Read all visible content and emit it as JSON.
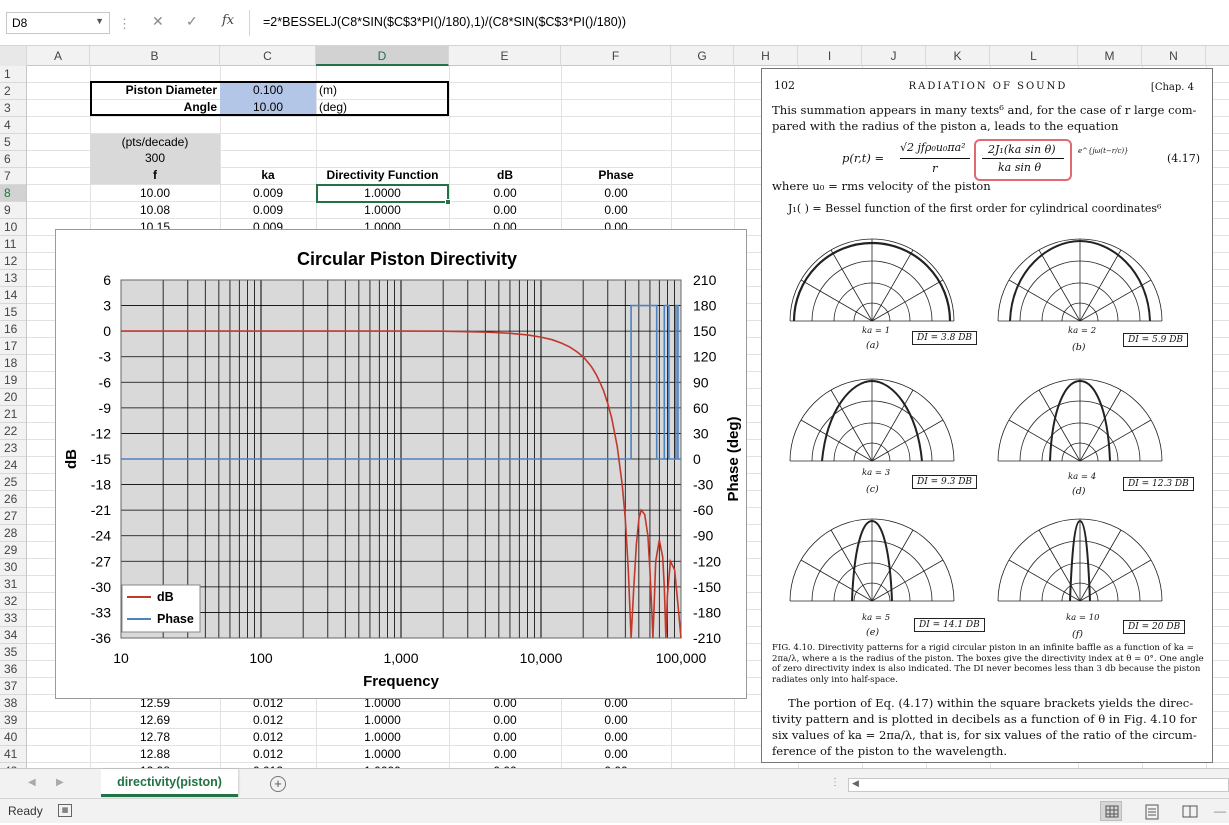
{
  "formula_bar": {
    "name_box": "D8",
    "formula": "=2*BESSELJ(C8*SIN($C$3*PI()/180),1)/(C8*SIN($C$3*PI()/180))"
  },
  "columns": [
    "A",
    "B",
    "C",
    "D",
    "E",
    "F",
    "G",
    "H",
    "I",
    "J",
    "K",
    "L",
    "M",
    "N"
  ],
  "rows": [
    "1",
    "2",
    "3",
    "4",
    "5",
    "6",
    "7",
    "8",
    "9",
    "10",
    "11",
    "12",
    "13",
    "14",
    "15",
    "16",
    "17",
    "18",
    "19",
    "20",
    "21",
    "22",
    "23",
    "24",
    "25",
    "26",
    "27",
    "28",
    "29",
    "30",
    "31",
    "32",
    "33",
    "34",
    "35",
    "36",
    "37",
    "38",
    "39",
    "40",
    "41",
    "42"
  ],
  "inputs": {
    "diameter_label": "Piston Diameter",
    "diameter_value": "0.100",
    "diameter_unit": "(m)",
    "angle_label": "Angle",
    "angle_value": "10.00",
    "angle_unit": "(deg)"
  },
  "pts": {
    "label": "(pts/decade)",
    "value": "300"
  },
  "headers": {
    "f": "f",
    "ka": "ka",
    "dir": "Directivity Function",
    "db": "dB",
    "phase": "Phase"
  },
  "table_top": [
    {
      "f": "10.00",
      "ka": "0.009",
      "dir": "1.0000",
      "db": "0.00",
      "phase": "0.00"
    },
    {
      "f": "10.08",
      "ka": "0.009",
      "dir": "1.0000",
      "db": "0.00",
      "phase": "0.00"
    },
    {
      "f": "10.15",
      "ka": "0.009",
      "dir": "1.0000",
      "db": "0.00",
      "phase": "0.00"
    }
  ],
  "table_bottom": [
    {
      "f": "12.59",
      "ka": "0.012",
      "dir": "1.0000",
      "db": "0.00",
      "phase": "0.00"
    },
    {
      "f": "12.69",
      "ka": "0.012",
      "dir": "1.0000",
      "db": "0.00",
      "phase": "0.00"
    },
    {
      "f": "12.78",
      "ka": "0.012",
      "dir": "1.0000",
      "db": "0.00",
      "phase": "0.00"
    },
    {
      "f": "12.88",
      "ka": "0.012",
      "dir": "1.0000",
      "db": "0.00",
      "phase": "0.00"
    },
    {
      "f": "12.98",
      "ka": "0.012",
      "dir": "1.0000",
      "db": "0.00",
      "phase": "0.00"
    }
  ],
  "chart_data": {
    "type": "line",
    "title": "Circular Piston Directivity",
    "xlabel": "Frequency",
    "ylabel": "dB",
    "y2label": "Phase (deg)",
    "x_scale": "log",
    "xlim": [
      10,
      100000
    ],
    "ylim": [
      -36,
      6
    ],
    "y2lim": [
      -210,
      210
    ],
    "x_ticks": [
      "10",
      "100",
      "1,000",
      "10,000",
      "100,000"
    ],
    "y_ticks": [
      "6",
      "3",
      "0",
      "-3",
      "-6",
      "-9",
      "-12",
      "-15",
      "-18",
      "-21",
      "-24",
      "-27",
      "-30",
      "-33",
      "-36"
    ],
    "y2_ticks": [
      "210",
      "180",
      "150",
      "120",
      "90",
      "60",
      "30",
      "0",
      "-30",
      "-60",
      "-90",
      "-120",
      "-150",
      "-180",
      "-210"
    ],
    "legend_position": "bottom-left",
    "grid": true,
    "series": [
      {
        "name": "dB",
        "color": "#c0392b",
        "axis": "left",
        "x": [
          10,
          1000,
          2000,
          4000,
          6000,
          8000,
          10000,
          12000,
          14000,
          16000,
          18000,
          20000,
          21000,
          22000,
          23000,
          24000,
          25000,
          26000,
          27000,
          28000,
          30000,
          32000,
          35000,
          38000,
          40000,
          42000,
          44000,
          46000,
          48000,
          50000,
          52000,
          55000,
          58000,
          60000,
          62000,
          63000,
          64000,
          66000,
          70000,
          74000,
          76000,
          78000,
          80000,
          84000,
          90000,
          95000,
          100000
        ],
        "y": [
          0.0,
          0.0,
          -0.01,
          -0.11,
          -0.25,
          -0.44,
          -0.7,
          -1.0,
          -1.4,
          -1.85,
          -2.4,
          -3.0,
          -3.4,
          -3.8,
          -4.2,
          -4.7,
          -5.2,
          -5.8,
          -6.4,
          -7.0,
          -8.5,
          -10.2,
          -13.5,
          -18.0,
          -22.0,
          -28.0,
          -36.0,
          -30.0,
          -25.0,
          -22.0,
          -21.0,
          -21.5,
          -24.0,
          -28.0,
          -33.0,
          -36.0,
          -33.0,
          -27.0,
          -24.5,
          -26.5,
          -30.0,
          -36.0,
          -31.0,
          -27.0,
          -28.0,
          -32.0,
          -36.0
        ]
      },
      {
        "name": "Phase",
        "color": "#4f81bd",
        "axis": "right",
        "x": [
          10,
          44000,
          44000,
          67000,
          67000,
          76000,
          76000,
          82000,
          82000,
          92000,
          92000,
          95000,
          95000,
          100000
        ],
        "y": [
          0,
          0,
          180,
          180,
          0,
          0,
          180,
          180,
          0,
          0,
          180,
          180,
          0,
          0
        ]
      }
    ]
  },
  "page": {
    "number": "102",
    "title": "RADIATION OF SOUND",
    "chapter": "[Chap. 4",
    "para1_l1": "This summation appears in many texts⁶ and, for the case of r large com-",
    "para1_l2": "pared with the radius of the piston a, leads to the equation",
    "eq_lhs": "p(r,t) =",
    "eq_num": "√2 jfρ₀u₀πa²",
    "eq_den": "r",
    "eq_box_num": "2J₁(ka sin θ)",
    "eq_box_den": "ka sin θ",
    "eq_exp": "e^{jω(t−r/c)}",
    "eq_no": "(4.17)",
    "where1": "where u₀ = rms velocity of the piston",
    "where2": "J₁( ) = Bessel function of the first order for cylindrical coordinates⁶",
    "plots": [
      {
        "ka": "ka = 1",
        "di": "DI = 3.8 DB",
        "letter": "(a)"
      },
      {
        "ka": "ka = 2",
        "di": "DI = 5.9 DB",
        "letter": "(b)"
      },
      {
        "ka": "ka = 3",
        "di": "DI = 9.3 DB",
        "letter": "(c)"
      },
      {
        "ka": "ka = 4",
        "di": "DI = 12.3 DB",
        "letter": "(d)"
      },
      {
        "ka": "ka = 5",
        "di": "DI = 14.1 DB",
        "letter": "(e)"
      },
      {
        "ka": "ka = 10",
        "di": "DI = 20 DB",
        "letter": "(f)"
      }
    ],
    "caption": "FIG. 4.10. Directivity patterns for a rigid circular piston in an infinite baffle as a function of ka = 2πa/λ, where a is the radius of the piston. The boxes give the directivity index at θ = 0°. One angle of zero directivity index is also indicated. The DI never becomes less than 3 db because the piston radiates only into half-space.",
    "para2_l1": "The portion of Eq. (4.17) within the square brackets yields the direc-",
    "para2_l2": "tivity pattern and is plotted in decibels as a function of θ in Fig. 4.10 for",
    "para2_l3": "six values of ka = 2πa/λ, that is, for six values of the ratio of the circum-",
    "para2_l4": "ference of the piston to the wavelength."
  },
  "sheet_tab": "directivity(piston)",
  "status": {
    "ready": "Ready"
  }
}
